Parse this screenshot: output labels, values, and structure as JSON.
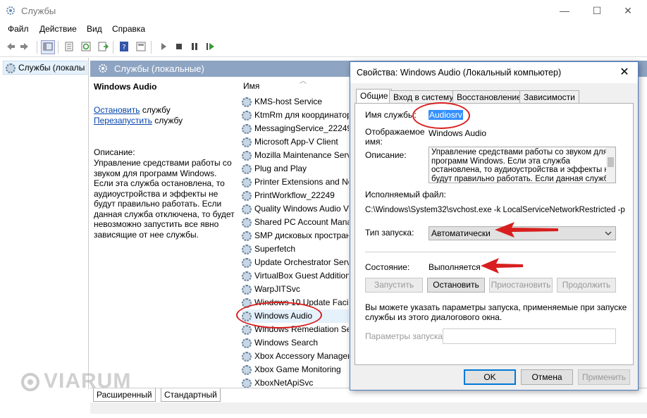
{
  "window": {
    "title": "Службы"
  },
  "menu": [
    "Файл",
    "Действие",
    "Вид",
    "Справка"
  ],
  "tree": {
    "root": "Службы (локалы"
  },
  "content": {
    "header": "Службы (локальные)",
    "selected_service": "Windows Audio",
    "stop_link": "Остановить",
    "stop_suffix": " службу",
    "restart_link": "Перезапустить",
    "restart_suffix": " службу",
    "desc_label": "Описание:",
    "description_lines": [
      "Управление средствами работы со",
      "звуком для программ Windows.",
      "Если эта служба остановлена, то",
      "аудиоустройства и эффекты не",
      "будут правильно работать.  Если",
      "данная служба отключена, то будет",
      "невозможно запустить все явно",
      "зависящие от нее службы."
    ]
  },
  "list": {
    "column": "Имя",
    "rows": [
      "KMS-host Service",
      "KtmRm для координатор",
      "MessagingService_22249",
      "Microsoft App-V Client",
      "Mozilla Maintenance Serv",
      "Plug and Play",
      "Printer Extensions and No",
      "PrintWorkflow_22249",
      "Quality Windows Audio V",
      "Shared PC Account Mana",
      "SMP дисковых простран",
      "Superfetch",
      "Update Orchestrator Serv",
      "VirtualBox Guest Addition",
      "WarpJITSvc",
      "Windows 10 Update Facil",
      "Windows Audio",
      "Windows Remediation Se",
      "Windows Search",
      "Xbox Accessory Manager",
      "Xbox Game Monitoring",
      "XboxNetApiSvc"
    ]
  },
  "bottom_tabs": [
    "Расширенный",
    "Стандартный"
  ],
  "dialog": {
    "title": "Свойства: Windows Audio (Локальный компьютер)",
    "tabs": [
      "Общие",
      "Вход в систему",
      "Восстановление",
      "Зависимости"
    ],
    "service_name_label": "Имя службы:",
    "service_name": "Audiosrv",
    "display_name_label_1": "Отображаемое",
    "display_name_label_2": "имя:",
    "display_name": "Windows Audio",
    "description_label": "Описание:",
    "description_lines": [
      "Управление средствами работы со звуком для",
      "программ Windows.  Если эта служба",
      "остановлена, то аудиоустройства и эффекты не",
      "будут правильно работать.  Если данная служба"
    ],
    "exe_label": "Исполняемый файл:",
    "exe_path": "C:\\Windows\\System32\\svchost.exe -k LocalServiceNetworkRestricted -p",
    "startup_label": "Тип запуска:",
    "startup_value": "Автоматически",
    "state_label": "Состояние:",
    "state_value": "Выполняется",
    "btn_start": "Запустить",
    "btn_stop": "Остановить",
    "btn_pause": "Приостановить",
    "btn_resume": "Продолжить",
    "hint_1": "Вы можете указать параметры запуска, применяемые при запуске",
    "hint_2": "службы из этого диалогового окна.",
    "params_label": "Параметры запуска:",
    "ok": "OK",
    "cancel": "Отмена",
    "apply": "Применить"
  },
  "watermark": "VIARUM",
  "colors": {
    "annotation": "#d81e1e",
    "header": "#8ea4c3",
    "selection": "#3390ff",
    "link": "#0645ad"
  }
}
